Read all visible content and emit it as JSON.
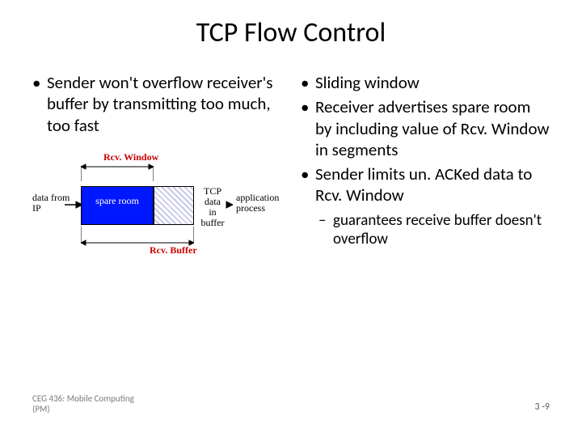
{
  "title": "TCP Flow Control",
  "left": {
    "b1": "Sender won't overflow receiver's buffer by transmitting too much, too fast"
  },
  "right": {
    "b1": "Sliding window",
    "b2": "Receiver advertises spare room by including value of Rcv. Window in segments",
    "b3": "Sender limits un. ACKed data to Rcv. Window",
    "s1": "guarantees receive buffer doesn't overflow"
  },
  "diagram": {
    "rcvwindow": "Rcv. Window",
    "datafromip": "data from\nIP",
    "spareroom": "spare room",
    "tcpdata": "TCP\ndata\nin buffer",
    "appproc": "application\nprocess",
    "rcvbuffer": "Rcv. Buffer"
  },
  "footer": {
    "left": "CEG 436: Mobile Computing\n(PM)",
    "right": "3 -9"
  }
}
